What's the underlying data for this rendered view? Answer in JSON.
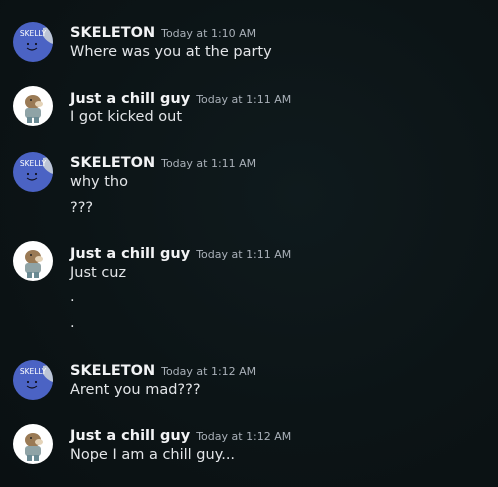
{
  "colors": {
    "skeleton_avatar_bg": "#4b63c4",
    "chillguy_avatar_bg": "#ffffff",
    "username": "#f2f3f5",
    "timestamp": "#a9b0b8",
    "message_text": "#e3e5e8"
  },
  "messages": [
    {
      "author": "SKELETON",
      "avatar_label": "SKELLY",
      "avatar_icon": "skelly-avatar-icon",
      "timestamp": "Today at 1:10 AM",
      "lines": [
        "Where was you at the party"
      ]
    },
    {
      "author": "Just a chill guy",
      "avatar_icon": "chill-guy-avatar-icon",
      "timestamp": "Today at 1:11 AM",
      "lines": [
        "I got kicked out"
      ]
    },
    {
      "author": "SKELETON",
      "avatar_label": "SKELLY",
      "avatar_icon": "skelly-avatar-icon",
      "timestamp": "Today at 1:11 AM",
      "lines": [
        "why tho",
        "???"
      ]
    },
    {
      "author": "Just a chill guy",
      "avatar_icon": "chill-guy-avatar-icon",
      "timestamp": "Today at 1:11 AM",
      "lines": [
        "Just cuz",
        ".",
        "."
      ]
    },
    {
      "author": "SKELETON",
      "avatar_label": "SKELLY",
      "avatar_icon": "skelly-avatar-icon",
      "timestamp": "Today at 1:12 AM",
      "lines": [
        "Arent you mad???"
      ]
    },
    {
      "author": "Just a chill guy",
      "avatar_icon": "chill-guy-avatar-icon",
      "timestamp": "Today at 1:12 AM",
      "lines": [
        "Nope I am a chill guy..."
      ]
    }
  ]
}
